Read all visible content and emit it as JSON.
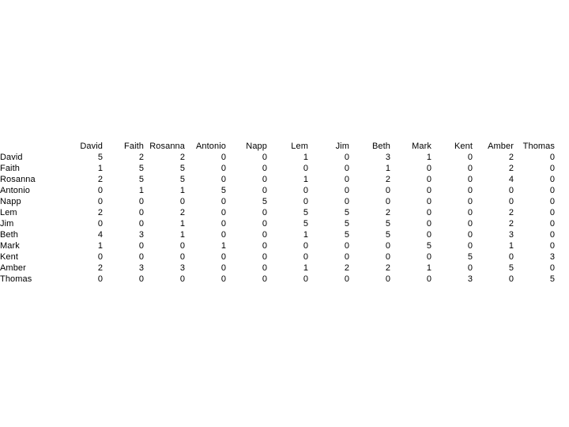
{
  "page": {
    "background_color": "#ffffff",
    "text_color": "#000000"
  },
  "matrix": {
    "corner_label": "",
    "column_headers": [
      "David",
      "Faith",
      "Rosanna",
      "Antonio",
      "Napp",
      "Lem",
      "Jim",
      "Beth",
      "Mark",
      "Kent",
      "Amber",
      "Thomas"
    ],
    "row_headers": [
      "David",
      "Faith",
      "Rosanna",
      "Antonio",
      "Napp",
      "Lem",
      "Jim",
      "Beth",
      "Mark",
      "Kent",
      "Amber",
      "Thomas"
    ],
    "rows": [
      {
        "label": "David",
        "values": [
          "5",
          "2",
          "2",
          "0",
          "0",
          "1",
          "0",
          "3",
          "1",
          "0",
          "2",
          "0"
        ]
      },
      {
        "label": "Faith",
        "values": [
          "1",
          "5",
          "5",
          "0",
          "0",
          "0",
          "0",
          "1",
          "0",
          "0",
          "2",
          "0"
        ]
      },
      {
        "label": "Rosanna",
        "values": [
          "2",
          "5",
          "5",
          "0",
          "0",
          "1",
          "0",
          "2",
          "0",
          "0",
          "4",
          "0"
        ]
      },
      {
        "label": "Antonio",
        "values": [
          "0",
          "1",
          "1",
          "5",
          "0",
          "0",
          "0",
          "0",
          "0",
          "0",
          "0",
          "0"
        ]
      },
      {
        "label": "Napp",
        "values": [
          "0",
          "0",
          "0",
          "0",
          "5",
          "0",
          "0",
          "0",
          "0",
          "0",
          "0",
          "0"
        ]
      },
      {
        "label": "Lem",
        "values": [
          "2",
          "0",
          "2",
          "0",
          "0",
          "5",
          "5",
          "2",
          "0",
          "0",
          "2",
          "0"
        ]
      },
      {
        "label": "Jim",
        "values": [
          "0",
          "0",
          "1",
          "0",
          "0",
          "5",
          "5",
          "5",
          "0",
          "0",
          "2",
          "0"
        ]
      },
      {
        "label": "Beth",
        "values": [
          "4",
          "3",
          "1",
          "0",
          "0",
          "1",
          "5",
          "5",
          "0",
          "0",
          "3",
          "0"
        ]
      },
      {
        "label": "Mark",
        "values": [
          "1",
          "0",
          "0",
          "1",
          "0",
          "0",
          "0",
          "0",
          "5",
          "0",
          "1",
          "0"
        ]
      },
      {
        "label": "Kent",
        "values": [
          "0",
          "0",
          "0",
          "0",
          "0",
          "0",
          "0",
          "0",
          "0",
          "5",
          "0",
          "3"
        ]
      },
      {
        "label": "Amber",
        "values": [
          "2",
          "3",
          "3",
          "0",
          "0",
          "1",
          "2",
          "2",
          "1",
          "0",
          "5",
          "0"
        ]
      },
      {
        "label": "Thomas",
        "values": [
          "0",
          "0",
          "0",
          "0",
          "0",
          "0",
          "0",
          "0",
          "0",
          "3",
          "0",
          "5"
        ]
      }
    ]
  },
  "chart_data": {
    "type": "table",
    "title": "",
    "xlabel": "",
    "ylabel": "",
    "categories": [
      "David",
      "Faith",
      "Rosanna",
      "Antonio",
      "Napp",
      "Lem",
      "Jim",
      "Beth",
      "Mark",
      "Kent",
      "Amber",
      "Thomas"
    ],
    "row_categories": [
      "David",
      "Faith",
      "Rosanna",
      "Antonio",
      "Napp",
      "Lem",
      "Jim",
      "Beth",
      "Mark",
      "Kent",
      "Amber",
      "Thomas"
    ],
    "matrix": [
      [
        5,
        2,
        2,
        0,
        0,
        1,
        0,
        3,
        1,
        0,
        2,
        0
      ],
      [
        1,
        5,
        5,
        0,
        0,
        0,
        0,
        1,
        0,
        0,
        2,
        0
      ],
      [
        2,
        5,
        5,
        0,
        0,
        1,
        0,
        2,
        0,
        0,
        4,
        0
      ],
      [
        0,
        1,
        1,
        5,
        0,
        0,
        0,
        0,
        0,
        0,
        0,
        0
      ],
      [
        0,
        0,
        0,
        0,
        5,
        0,
        0,
        0,
        0,
        0,
        0,
        0
      ],
      [
        2,
        0,
        2,
        0,
        0,
        5,
        5,
        2,
        0,
        0,
        2,
        0
      ],
      [
        0,
        0,
        1,
        0,
        0,
        5,
        5,
        5,
        0,
        0,
        2,
        0
      ],
      [
        4,
        3,
        1,
        0,
        0,
        1,
        5,
        5,
        0,
        0,
        3,
        0
      ],
      [
        1,
        0,
        0,
        1,
        0,
        0,
        0,
        0,
        5,
        0,
        1,
        0
      ],
      [
        0,
        0,
        0,
        0,
        0,
        0,
        0,
        0,
        0,
        5,
        0,
        3
      ],
      [
        2,
        3,
        3,
        0,
        0,
        1,
        2,
        2,
        1,
        0,
        5,
        0
      ],
      [
        0,
        0,
        0,
        0,
        0,
        0,
        0,
        0,
        0,
        3,
        0,
        5
      ]
    ],
    "value_range": [
      0,
      5
    ],
    "grid": false,
    "legend": "none"
  }
}
